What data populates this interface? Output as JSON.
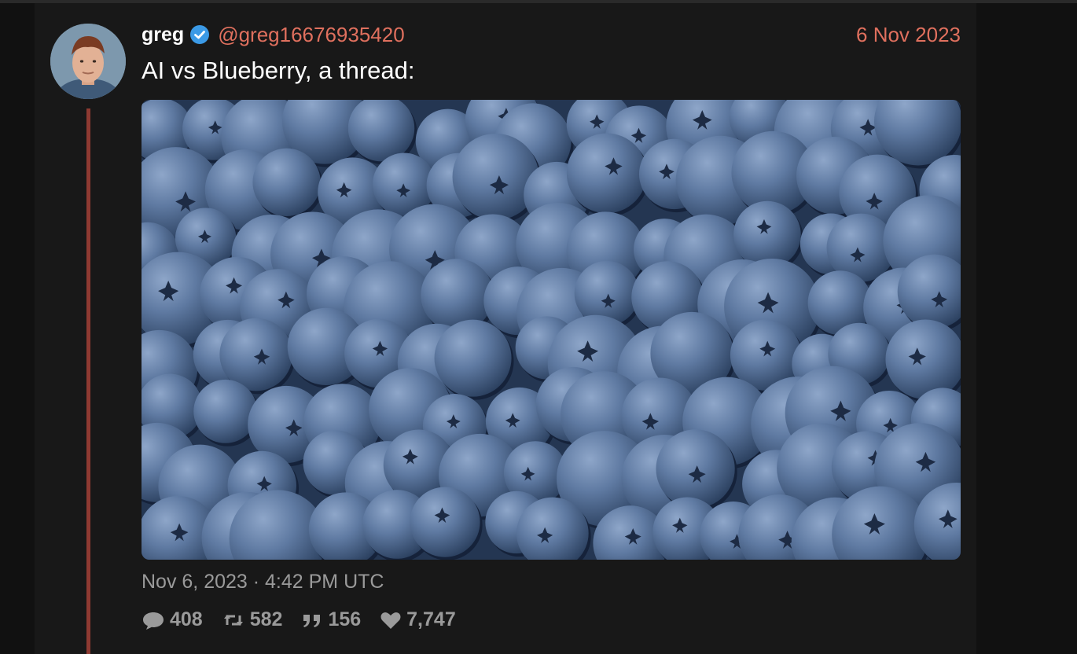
{
  "tweet": {
    "display_name": "greg",
    "handle": "@greg16676935420",
    "date_short": "6 Nov 2023",
    "text": "AI vs Blueberry, a thread:",
    "timestamp": "Nov 6, 2023 · 4:42 PM UTC",
    "media_description": "close-up photo of many blueberries"
  },
  "stats": {
    "replies": "408",
    "retweets": "582",
    "quotes": "156",
    "likes": "7,747"
  },
  "colors": {
    "accent": "#e0705e",
    "thread_line": "#8e3a32",
    "verified": "#3b9ae6",
    "muted_text": "#9a9a9a"
  },
  "icons": [
    "verified-badge-icon",
    "reply-icon",
    "retweet-icon",
    "quote-icon",
    "like-icon"
  ]
}
